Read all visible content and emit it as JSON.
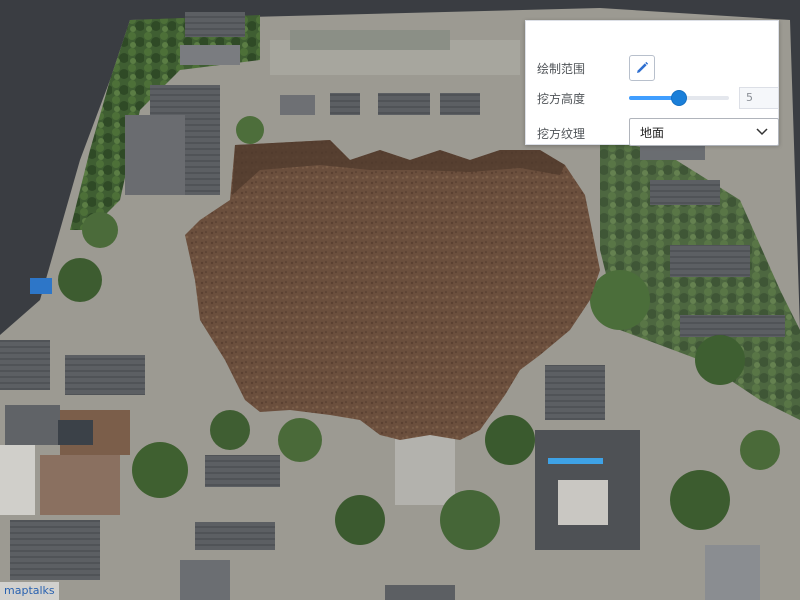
{
  "panel": {
    "draw_label": "绘制范围",
    "height_label": "挖方高度",
    "height_value": "5",
    "height_slider_fraction": 0.5,
    "texture_label": "挖方纹理",
    "texture_selected": "地面",
    "draw_icon": "pencil-icon",
    "select_icon": "chevron-down-icon"
  },
  "map": {
    "attribution": "maptalks",
    "colors": {
      "water": "#3a3d42",
      "excavation": "#6e5240",
      "accent": "#409eff",
      "roof": "#55585c"
    }
  }
}
